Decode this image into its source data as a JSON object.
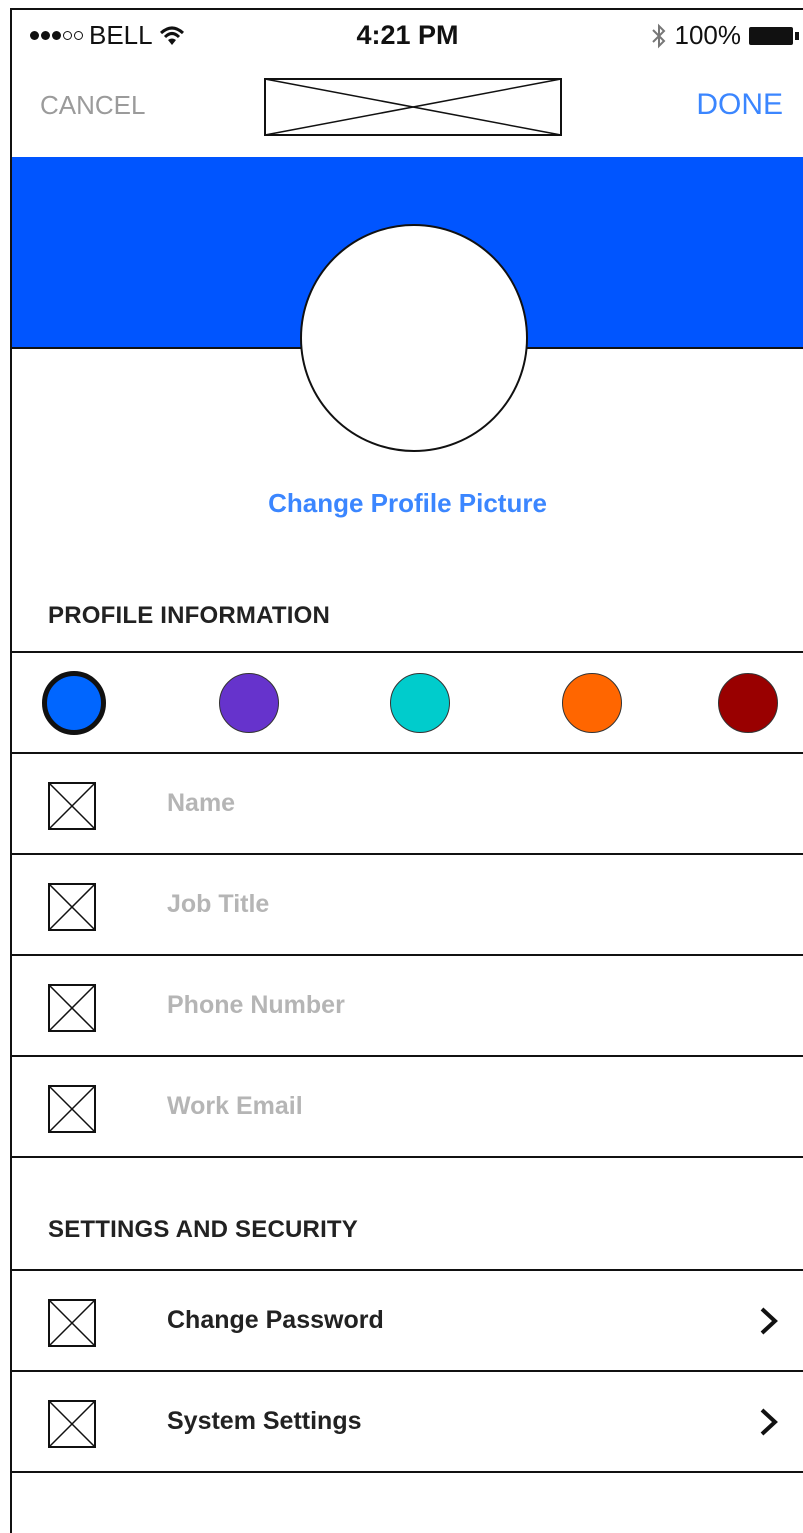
{
  "status_bar": {
    "carrier": "BELL",
    "time": "4:21 PM",
    "battery": "100%"
  },
  "nav": {
    "cancel_label": "CANCEL",
    "done_label": "DONE"
  },
  "profile": {
    "change_picture_label": "Change Profile Picture"
  },
  "sections": {
    "profile_info_title": "PROFILE INFORMATION",
    "settings_title": "SETTINGS AND SECURITY"
  },
  "colors": {
    "accent": "#3b86ff",
    "banner": "#0055ff"
  },
  "color_swatches": [
    {
      "name": "blue",
      "hex": "#0066ff",
      "selected": true
    },
    {
      "name": "purple",
      "hex": "#6633cc",
      "selected": false
    },
    {
      "name": "teal",
      "hex": "#00cccc",
      "selected": false
    },
    {
      "name": "orange",
      "hex": "#ff6600",
      "selected": false
    },
    {
      "name": "dark-red",
      "hex": "#990000",
      "selected": false
    }
  ],
  "fields": [
    {
      "placeholder": "Name"
    },
    {
      "placeholder": "Job Title"
    },
    {
      "placeholder": "Phone Number"
    },
    {
      "placeholder": "Work Email"
    }
  ],
  "settings": [
    {
      "label": "Change Password"
    },
    {
      "label": "System Settings"
    }
  ]
}
